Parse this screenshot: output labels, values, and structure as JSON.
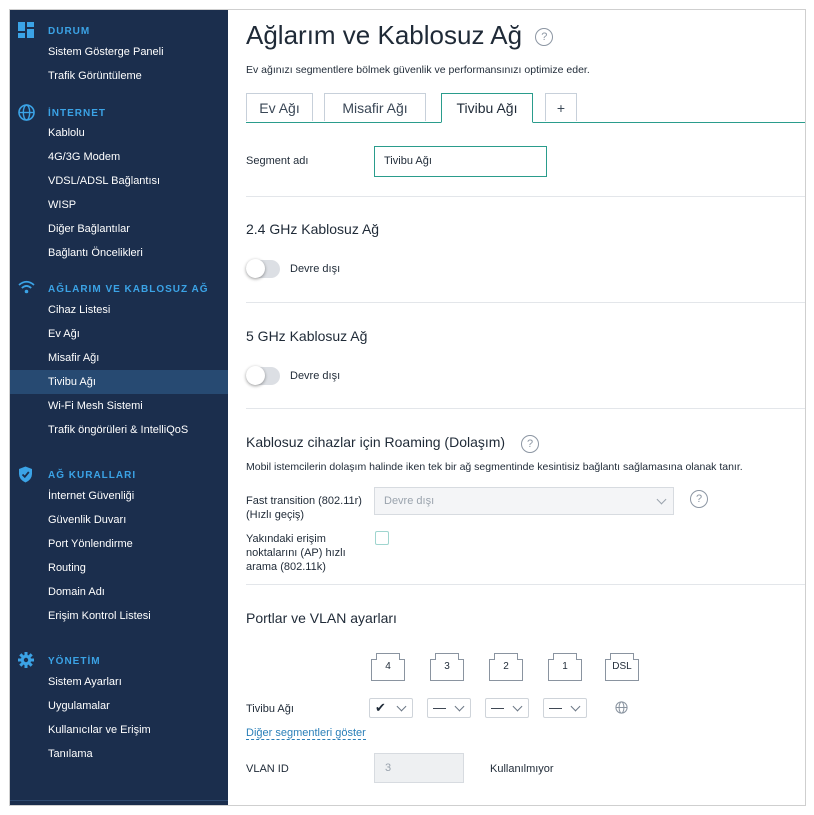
{
  "sidebar": {
    "sections": [
      {
        "icon": "dashboard-icon",
        "title": "DURUM",
        "items": [
          "Sistem Gösterge Paneli",
          "Trafik Görüntüleme"
        ]
      },
      {
        "icon": "globe-icon",
        "title": "İNTERNET",
        "items": [
          "Kablolu",
          "4G/3G Modem",
          "VDSL/ADSL Bağlantısı",
          "WISP",
          "Diğer Bağlantılar",
          "Bağlantı Öncelikleri"
        ]
      },
      {
        "icon": "wifi-icon",
        "title": "AĞLARIM VE KABLOSUZ AĞ",
        "items": [
          "Cihaz Listesi",
          "Ev Ağı",
          "Misafir Ağı",
          "Tivibu Ağı",
          "Wi-Fi Mesh Sistemi",
          "Trafik öngörüleri & IntelliQoS"
        ]
      },
      {
        "icon": "shield-icon",
        "title": "AĞ KURALLARI",
        "items": [
          "İnternet Güvenliği",
          "Güvenlik Duvarı",
          "Port Yönlendirme",
          "Routing",
          "Domain Adı",
          "Erişim Kontrol Listesi"
        ]
      },
      {
        "icon": "gear-icon",
        "title": "YÖNETİM",
        "items": [
          "Sistem Ayarları",
          "Uygulamalar",
          "Kullanıcılar ve Erişim",
          "Tanılama"
        ]
      }
    ],
    "active_item": "Tivibu Ağı"
  },
  "main": {
    "title": "Ağlarım ve Kablosuz Ağ",
    "help_glyph": "?",
    "subtitle": "Ev ağınızı segmentlere bölmek güvenlik ve performansınızı optimize eder.",
    "tabs": [
      "Ev Ağı",
      "Misafir Ağı",
      "Tivibu Ağı",
      "+"
    ],
    "active_tab": "Tivibu Ağı",
    "segment_label": "Segment adı",
    "segment_value": "Tivibu Ağı",
    "wifi24": {
      "title": "2.4 GHz Kablosuz Ağ",
      "state": "Devre dışı",
      "enabled": false
    },
    "wifi5": {
      "title": "5 GHz Kablosuz Ağ",
      "state": "Devre dışı",
      "enabled": false
    },
    "roaming": {
      "title": "Kablosuz cihazlar için Roaming (Dolaşım)",
      "description": "Mobil istemcilerin dolaşım halinde iken tek bir ağ segmentinde kesintisiz bağlantı sağlamasına olanak tanır.",
      "fast_label_1": "Fast transition (802.11r)",
      "fast_label_2": "(Hızlı geçiş)",
      "fast_value": "Devre dışı",
      "ap_label_1": "Yakındaki erişim",
      "ap_label_2": "noktalarını (AP) hızlı",
      "ap_label_3": "arama (802.11k)",
      "ap_checked": false
    },
    "ports": {
      "title": "Portlar ve VLAN ayarları",
      "port_labels": [
        "4",
        "3",
        "2",
        "1",
        "DSL"
      ],
      "row_label": "Tivibu Ağı",
      "row_values": [
        "✔",
        "—",
        "—",
        "—"
      ],
      "show_other": "Diğer segmentleri göster",
      "vlan_label": "VLAN ID",
      "vlan_value": "3",
      "vlan_status": "Kullanılmıyor"
    }
  },
  "colors": {
    "sidebar_bg": "#1b2e4d",
    "accent": "#2a9c8c",
    "section_title": "#3ba3e6",
    "active_item_bg": "#274a72"
  }
}
